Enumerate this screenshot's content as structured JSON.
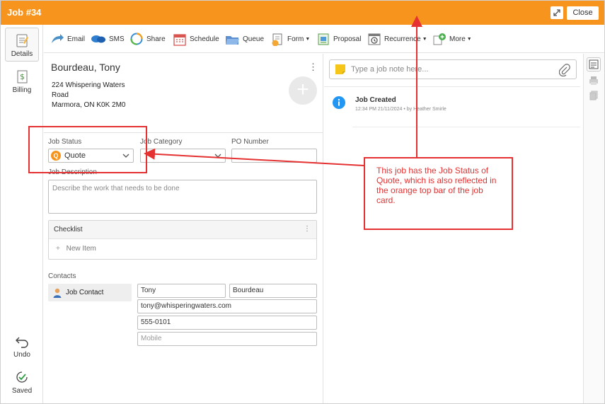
{
  "titlebar": {
    "title": "Job #34",
    "close_label": "Close"
  },
  "rail": {
    "details": "Details",
    "billing": "Billing",
    "undo": "Undo",
    "saved": "Saved"
  },
  "toolbar": {
    "email": "Email",
    "sms": "SMS",
    "share": "Share",
    "schedule": "Schedule",
    "queue": "Queue",
    "form": "Form",
    "proposal": "Proposal",
    "recurrence": "Recurrence",
    "more": "More"
  },
  "customer": {
    "name": "Bourdeau, Tony",
    "address_line1": "224 Whispering Waters",
    "address_line2": "Road",
    "address_line3": "Marmora, ON K0K 2M0"
  },
  "fields": {
    "job_status_label": "Job Status",
    "job_status_value": "Quote",
    "job_status_badge": "Q",
    "job_category_label": "Job Category",
    "po_number_label": "PO Number",
    "job_description_label": "Job Description",
    "job_description_placeholder": "Describe the work that needs to be done"
  },
  "checklist": {
    "title": "Checklist",
    "new_item": "New Item"
  },
  "contacts": {
    "label": "Contacts",
    "type": "Job Contact",
    "first_name": "Tony",
    "last_name": "Bourdeau",
    "email": "tony@whisperingwaters.com",
    "phone": "555-0101",
    "mobile_placeholder": "Mobile"
  },
  "notes": {
    "placeholder": "Type a job note here..."
  },
  "activity": {
    "title": "Job Created",
    "meta": "12:34 PM 21/11/2024 • by Heather Smirle"
  },
  "annotation": {
    "text": "This job has the Job Status of Quote, which is also reflected in the orange top bar of the job card.",
    "color": "#e53131"
  },
  "colors": {
    "status_orange": "#f7941d",
    "info_blue": "#2196f3"
  }
}
